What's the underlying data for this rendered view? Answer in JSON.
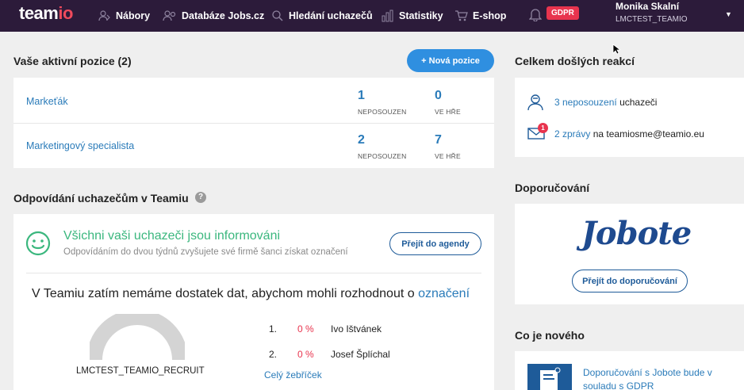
{
  "nav": {
    "logo_main": "team",
    "logo_accent": "io",
    "items": [
      {
        "label": "Nábory",
        "icon": "people-icon"
      },
      {
        "label": "Databáze Jobs.cz",
        "icon": "people-search-icon"
      },
      {
        "label": "Hledání uchazečů",
        "icon": "search-icon"
      },
      {
        "label": "Statistiky",
        "icon": "bar-chart-icon"
      },
      {
        "label": "E-shop",
        "icon": "cart-icon"
      }
    ],
    "gdpr": "GDPR",
    "user_name": "Monika Skalní",
    "user_account": "LMCTEST_TEAMIO"
  },
  "positions": {
    "title": "Vaše aktivní pozice (2)",
    "new_button": "+ Nová pozice",
    "rows": [
      {
        "name": "Markeťák",
        "unreviewed": "1",
        "unreviewed_label": "NEPOSOUZEN",
        "in_game": "0",
        "in_game_label": "VE HŘE"
      },
      {
        "name": "Marketingový specialista",
        "unreviewed": "2",
        "unreviewed_label": "NEPOSOUZEN",
        "in_game": "7",
        "in_game_label": "VE HŘE"
      }
    ]
  },
  "responses": {
    "title": "Celkem došlých reakcí",
    "candidates_link": "3 neposouzení",
    "candidates_text": "uchazeči",
    "messages_badge": "1",
    "messages_link": "2 zprávy",
    "messages_text": "na teamiosme@teamio.eu"
  },
  "answering": {
    "title": "Odpovídání uchazečům v Teamiu",
    "help": "?",
    "status_title": "Všichni vaši uchazeči jsou informováni",
    "status_sub": "Odpovídáním do dvou týdnů zvyšujete své firmě šanci získat označení",
    "agenda_button": "Přejít do agendy",
    "data_text": "V Teamiu zatím nemáme dostatek dat, abychom mohli rozhodnout o",
    "data_link": "označení",
    "gauge_label": "LMCTEST_TEAMIO_RECRUIT",
    "ranking": [
      {
        "rank": "1.",
        "pct": "0 %",
        "name": "Ivo Ištvánek"
      },
      {
        "rank": "2.",
        "pct": "0 %",
        "name": "Josef Šplíchal"
      }
    ],
    "ranking_link": "Celý žebříček"
  },
  "recommend": {
    "title": "Doporučování",
    "logo": "Jobote",
    "button": "Přejít do doporučování"
  },
  "news": {
    "title": "Co je nového",
    "item_line1": "Doporučování s Jobote bude v",
    "item_line2": "souladu s GDPR"
  }
}
